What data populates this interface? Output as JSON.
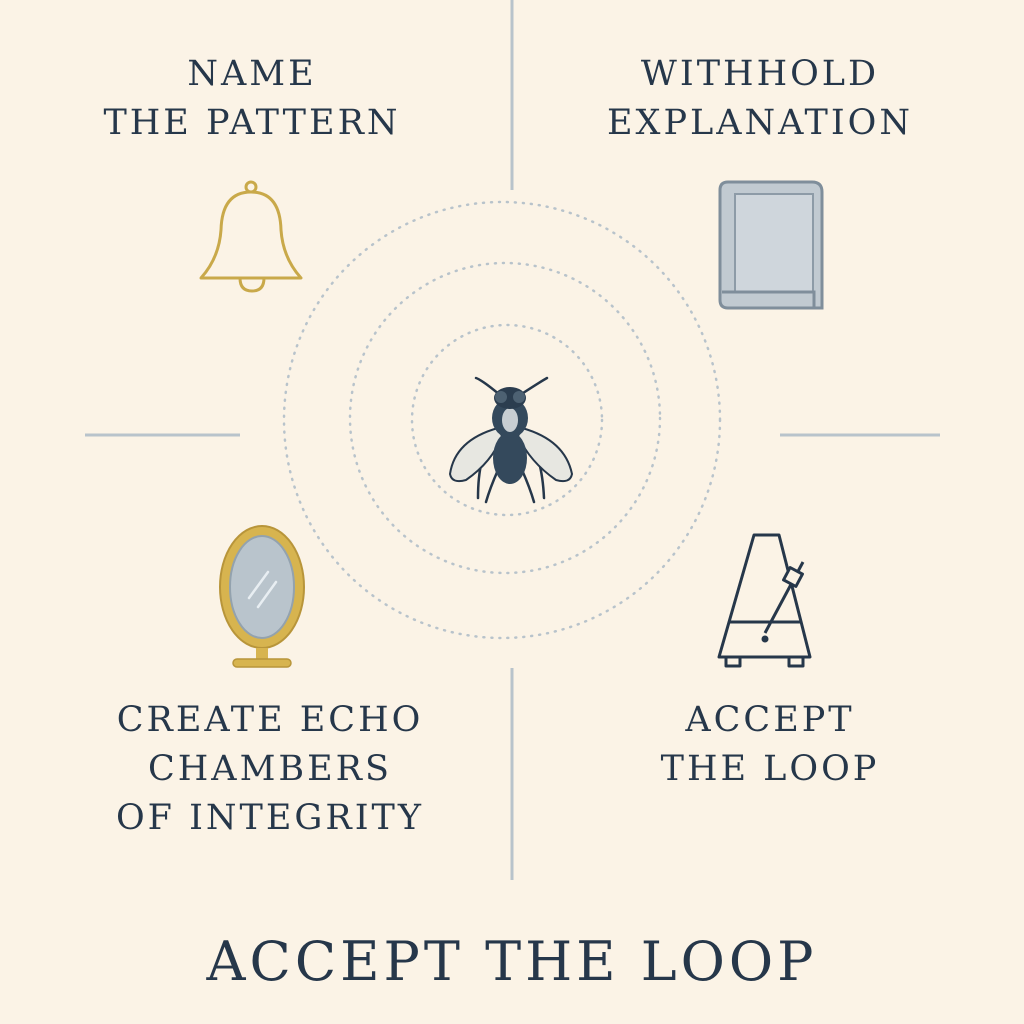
{
  "quadrants": {
    "top_left": {
      "lines": [
        "NAME",
        "THE PATTERN"
      ],
      "icon": "bell-icon"
    },
    "top_right": {
      "lines": [
        "WITHHOLD",
        "EXPLANATION"
      ],
      "icon": "book-icon"
    },
    "bottom_left": {
      "lines": [
        "CREATE ECHO",
        "CHAMBERS",
        "OF INTEGRITY"
      ],
      "icon": "mirror-icon"
    },
    "bottom_right": {
      "lines": [
        "ACCEPT",
        "THE LOOP"
      ],
      "icon": "metronome-icon"
    }
  },
  "center": {
    "icon": "fly-icon"
  },
  "footer": {
    "title": "ACCEPT THE LOOP"
  },
  "colors": {
    "background": "#fbf3e6",
    "text": "#26374a",
    "gold": "#c9a94a",
    "slate": "#a9b5bf",
    "divider": "#b8c3cb"
  }
}
